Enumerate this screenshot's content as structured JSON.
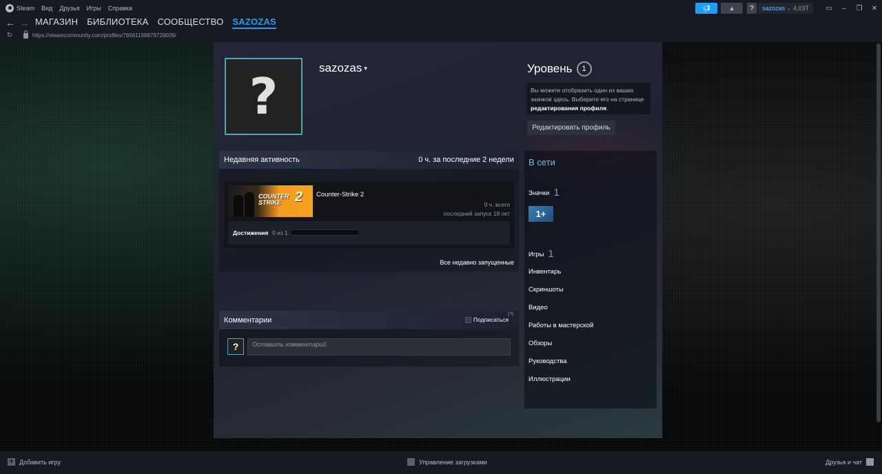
{
  "titlebar": {
    "app_name": "Steam",
    "menu": [
      "Вид",
      "Друзья",
      "Игры",
      "Справка"
    ],
    "username": "sazozas",
    "balance": "4,03Т"
  },
  "nav": {
    "tabs": [
      "МАГАЗИН",
      "БИБЛИОТЕКА",
      "СООБЩЕСТВО",
      "SAZOZAS"
    ],
    "active_tab": "SAZOZAS",
    "url": "https://steamcommunity.com/profiles/76561199879729009/"
  },
  "profile": {
    "name": "sazozas",
    "avatar_glyph": "?",
    "level_label": "Уровень",
    "level": "1",
    "level_info_1": "Вы можете отобразить один из ваших значков здесь. Выберите его на странице ",
    "level_info_link": "редактирования профиля",
    "level_info_end": ".",
    "edit_button": "Редактировать профиль"
  },
  "activity": {
    "title": "Недавняя активность",
    "summary": "0 ч. за последние 2 недели",
    "game": {
      "name": "Counter-Strike 2",
      "capsule_text_1": "COUNTER",
      "capsule_text_2": "STRIKE",
      "capsule_text_3": "2",
      "hours": "0 ч. всего",
      "last_played": "последний запуск 18 окт",
      "achievements_label": "Достижения",
      "achievements_count": "0 из 1",
      "achievements_progress": 0
    },
    "all_recent": "Все недавно запущенные"
  },
  "comments": {
    "title": "Комментарии",
    "subscribe": "Подписаться",
    "help": "(?)",
    "placeholder": "Оставить комментарий"
  },
  "sidebar": {
    "status": "В сети",
    "badges_label": "Значки",
    "badges_count": "1",
    "badge_text": "1+",
    "games_label": "Игры",
    "games_count": "1",
    "items": [
      "Инвентарь",
      "Скриншоты",
      "Видео",
      "Работы в мастерской",
      "Обзоры",
      "Руководства",
      "Иллюстрации"
    ]
  },
  "bottombar": {
    "add_game": "Добавить игру",
    "downloads": "Управление загрузками",
    "friends": "Друзья и чат"
  },
  "colors": {
    "accent": "#1a9fff",
    "online": "#57cbde",
    "avatar_border": "#53a4c4"
  }
}
